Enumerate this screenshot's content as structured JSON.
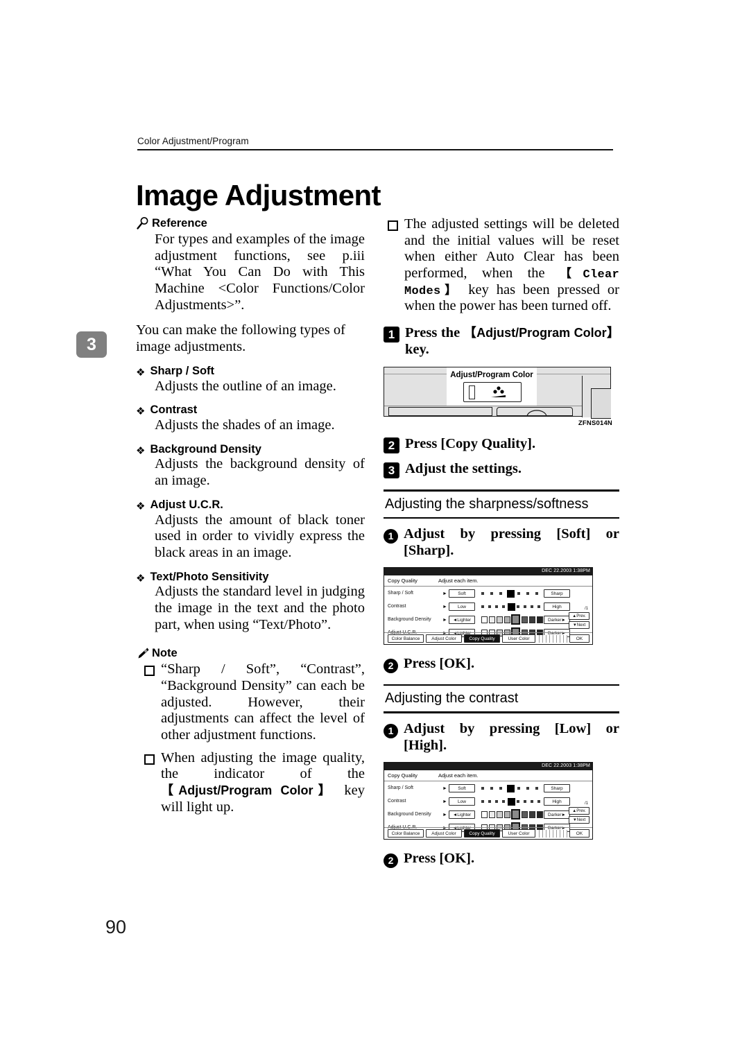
{
  "header": {
    "running_head": "Color Adjustment/Program"
  },
  "title": "Image Adjustment",
  "chapter_tab": "3",
  "page_number": "90",
  "left_column": {
    "reference": {
      "icon": "magnifier-icon",
      "heading": "Reference",
      "body": "For types and examples of the image adjustment functions, see p.iii “What You Can Do with This Machine <Color Functions/Color Adjustments>”."
    },
    "intro": "You can make the following types of image adjustments.",
    "features": [
      {
        "name": "Sharp / Soft",
        "desc": "Adjusts the outline of an image."
      },
      {
        "name": "Contrast",
        "desc": "Adjusts the shades of an image."
      },
      {
        "name": "Background Density",
        "desc": "Adjusts the background density of an image."
      },
      {
        "name": "Adjust U.C.R.",
        "desc": "Adjusts the amount of black toner used in order to vividly express the black areas in an image."
      },
      {
        "name": "Text/Photo Sensitivity",
        "desc": "Adjusts the standard level in judging the image in the text and the photo part, when using “Text/Photo”."
      }
    ],
    "note": {
      "icon": "pencil-icon",
      "heading": "Note",
      "items": [
        {
          "text_a": "“Sharp / Soft”, “Contrast”, “Background Density” can each be adjusted. However, their adjustments can affect the level of other adjustment functions."
        },
        {
          "pre": "When adjusting the image quality, the indicator of the ",
          "key": "【Adjust/Program Color】",
          "post": " key will light up."
        }
      ]
    }
  },
  "right_column": {
    "note_item": {
      "pre": "The adjusted settings will be deleted and the initial values will be reset when either Auto Clear has been performed, when the ",
      "key": "【Clear Modes】",
      "post": " key has been pressed or when the power has been turned off."
    },
    "steps": [
      {
        "num": "1",
        "pre": "Press the ",
        "key": "【Adjust/Program Color】",
        "post": " key."
      },
      {
        "num": "2",
        "text": "Press [Copy Quality]."
      },
      {
        "num": "3",
        "text": "Adjust the settings."
      }
    ],
    "panel_figure": {
      "key_label": "Adjust/Program Color",
      "figure_id": "ZFNS014N"
    },
    "subsections": [
      {
        "label": "Adjusting the sharpness/softness",
        "substeps": [
          {
            "num": "1",
            "text": "Adjust by pressing [Soft] or [Sharp]."
          },
          {
            "num": "2",
            "text": "Press [OK]."
          }
        ]
      },
      {
        "label": "Adjusting the contrast",
        "substeps": [
          {
            "num": "1",
            "text": "Adjust by pressing [Low] or [High]."
          },
          {
            "num": "2",
            "text": "Press [OK]."
          }
        ]
      }
    ],
    "lcd": {
      "status_datetime": "DEC  22.2003  1:38PM",
      "screen_title": "Copy Quality",
      "screen_prompt": "Adjust each item.",
      "rows": [
        {
          "name": "Sharp / Soft",
          "left_button": "Soft",
          "right_button": "Sharp",
          "type": "dots",
          "steps": 7,
          "selected": 4
        },
        {
          "name": "Contrast",
          "left_button": "Low",
          "right_button": "High",
          "type": "dots",
          "steps": 9,
          "selected": 5
        },
        {
          "name": "Background Density",
          "left_button": "◄Lighter",
          "right_button": "Darker►",
          "type": "swatches",
          "steps": 9,
          "selected": 5
        },
        {
          "name": "Adjust U.C.R.",
          "left_button": "◄Lighter",
          "right_button": "Darker►",
          "type": "swatches",
          "steps": 9,
          "selected": 5
        }
      ],
      "page_indicator": "/1",
      "nav_prev": "▲Prev.",
      "nav_next": "▼Next",
      "tabs": [
        {
          "label": "Color Balance",
          "selected": false
        },
        {
          "label": "Adjust Color",
          "selected": false
        },
        {
          "label": "Copy Quality",
          "selected": true
        },
        {
          "label": "User Color",
          "selected": false
        }
      ],
      "ok_button": "OK"
    }
  }
}
